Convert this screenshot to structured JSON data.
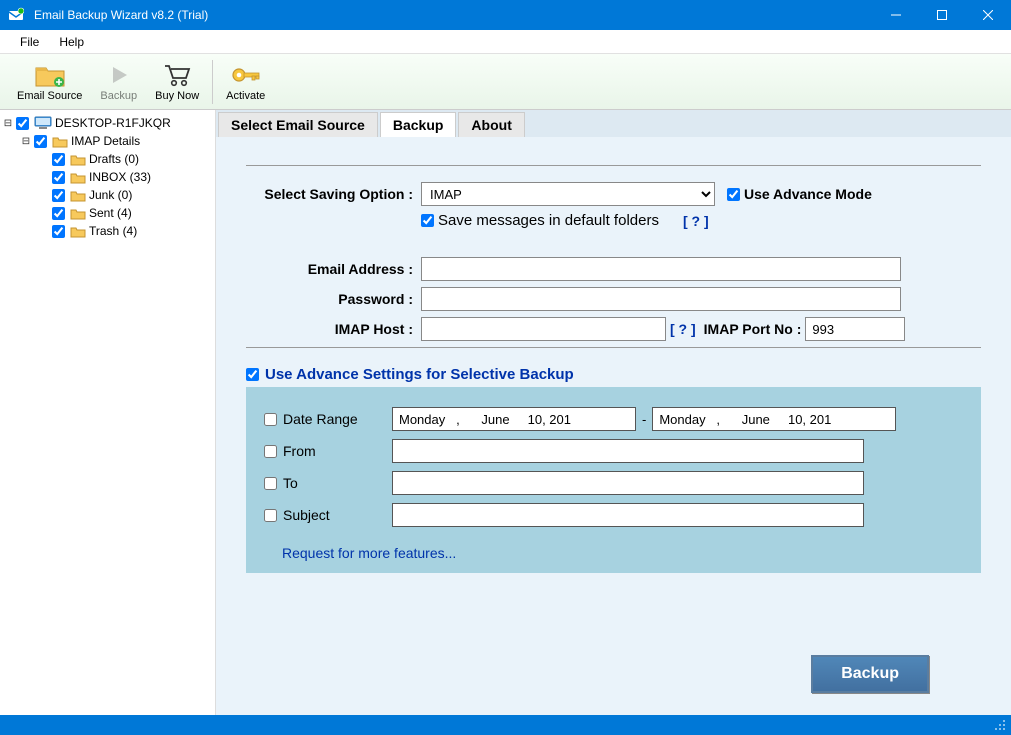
{
  "titlebar": {
    "title": "Email Backup Wizard v8.2 (Trial)"
  },
  "menubar": {
    "file": "File",
    "help": "Help"
  },
  "toolbar": {
    "email_source": "Email Source",
    "backup": "Backup",
    "buy_now": "Buy Now",
    "activate": "Activate"
  },
  "tree": {
    "root": "DESKTOP-R1FJKQR",
    "imap_details": "IMAP Details",
    "folders": [
      {
        "label": "Drafts (0)"
      },
      {
        "label": "INBOX (33)"
      },
      {
        "label": "Junk (0)"
      },
      {
        "label": "Sent (4)"
      },
      {
        "label": "Trash (4)"
      }
    ]
  },
  "tabs": {
    "select_source": "Select Email Source",
    "backup": "Backup",
    "about": "About"
  },
  "form": {
    "saving_option_label": "Select Saving Option :",
    "saving_option_value": "IMAP",
    "use_advance_mode": "Use Advance Mode",
    "save_default": "Save messages in default folders",
    "help_q": "[ ? ]",
    "email_label": "Email Address :",
    "email_value": "",
    "password_label": "Password :",
    "password_value": "",
    "imap_host_label": "IMAP Host :",
    "imap_host_value": "",
    "imap_port_label": "IMAP Port No :",
    "imap_port_value": "993"
  },
  "advanced": {
    "head": "Use Advance Settings for Selective Backup",
    "date_range": "Date Range",
    "date_from": "Monday   ,      June     10, 201",
    "date_to": "Monday   ,      June     10, 201",
    "from": "From",
    "from_value": "",
    "to": "To",
    "to_value": "",
    "subject": "Subject",
    "subject_value": "",
    "request_link": "Request for more features..."
  },
  "backup_button": "Backup"
}
